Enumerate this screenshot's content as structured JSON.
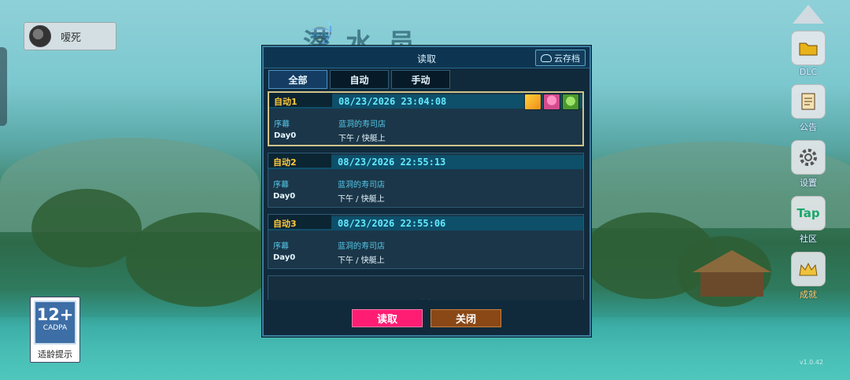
{
  "game": {
    "title": "潜水员"
  },
  "player": {
    "name": "嗳死"
  },
  "rightbar": [
    {
      "label": "DLC",
      "icon": "folder-icon"
    },
    {
      "label": "公告",
      "icon": "notice-icon"
    },
    {
      "label": "设置",
      "icon": "gear-icon"
    },
    {
      "label": "社区",
      "icon": "tap-icon",
      "glyph": "Tap"
    },
    {
      "label": "成就",
      "icon": "crown-icon"
    }
  ],
  "age_rating": {
    "age": "12+",
    "org": "CADPA",
    "tip": "适龄提示"
  },
  "version": "v1.0.42",
  "dialog": {
    "title": "读取",
    "cloud_save": "云存档",
    "tabs": [
      "全部",
      "自动",
      "手动"
    ],
    "active_tab": "全部",
    "slots": [
      {
        "label": "自动1",
        "datetime": "08/23/2026 23:04:08",
        "chapter": "序幕",
        "day": "Day0",
        "location": "蓝洞的寿司店",
        "time": "下午 / 快艇上",
        "selected": true
      },
      {
        "label": "自动2",
        "datetime": "08/23/2026 22:55:13",
        "chapter": "序幕",
        "day": "Day0",
        "location": "蓝洞的寿司店",
        "time": "下午 / 快艇上",
        "selected": false
      },
      {
        "label": "自动3",
        "datetime": "08/23/2026 22:55:06",
        "chapter": "序幕",
        "day": "Day0",
        "location": "蓝洞的寿司店",
        "time": "下午 / 快艇上",
        "selected": false
      }
    ],
    "empty_label": "空白",
    "load_button": "读取",
    "close_button": "关闭"
  }
}
